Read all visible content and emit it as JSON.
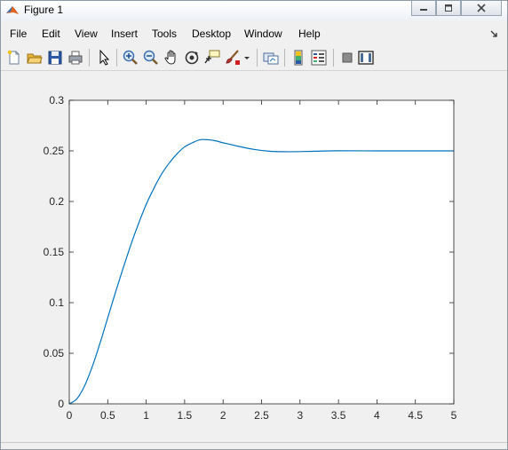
{
  "window": {
    "title": "Figure 1",
    "icons": {
      "app": "matlab-icon",
      "minimize": "minimize-icon",
      "maximize": "maximize-icon",
      "close": "close-icon"
    }
  },
  "menubar": {
    "items": [
      "File",
      "Edit",
      "View",
      "Insert",
      "Tools",
      "Desktop",
      "Window",
      "Help"
    ],
    "dock_icon": "dock-arrow-icon"
  },
  "toolbar": {
    "buttons": [
      "new-figure-icon",
      "open-file-icon",
      "save-icon",
      "print-icon",
      "edit-plot-pointer-icon",
      "zoom-in-icon",
      "zoom-out-icon",
      "pan-hand-icon",
      "rotate-3d-icon",
      "data-cursor-icon",
      "brush-icon",
      "brush-dropdown-icon",
      "link-plot-icon",
      "insert-colorbar-icon",
      "insert-legend-icon",
      "hide-plot-tools-icon",
      "show-plot-tools-icon"
    ]
  },
  "colors": {
    "line": "#0072bd",
    "axes_background": "#ffffff",
    "figure_background": "#f0f0f0",
    "axes_border": "#262626"
  },
  "chart_data": {
    "type": "line",
    "title": "",
    "xlabel": "",
    "ylabel": "",
    "xlim": [
      0,
      5
    ],
    "ylim": [
      0,
      0.3
    ],
    "xticks": [
      "0",
      "0.5",
      "1",
      "1.5",
      "2",
      "2.5",
      "3",
      "3.5",
      "4",
      "4.5",
      "5"
    ],
    "yticks": [
      "0",
      "0.05",
      "0.1",
      "0.15",
      "0.2",
      "0.25",
      "0.3"
    ],
    "grid": false,
    "legend": "none",
    "series": [
      {
        "x": [
          0,
          0.1,
          0.2,
          0.3,
          0.4,
          0.5,
          0.6,
          0.7,
          0.8,
          0.9,
          1.0,
          1.1,
          1.2,
          1.3,
          1.4,
          1.5,
          1.6,
          1.7,
          1.8,
          1.9,
          2.0,
          2.2,
          2.4,
          2.6,
          2.8,
          3.0,
          3.2,
          3.5,
          4.0,
          4.5,
          5.0
        ],
        "y": [
          0,
          0.005,
          0.018,
          0.037,
          0.06,
          0.085,
          0.11,
          0.134,
          0.157,
          0.178,
          0.197,
          0.213,
          0.227,
          0.238,
          0.247,
          0.254,
          0.258,
          0.261,
          0.261,
          0.26,
          0.258,
          0.2545,
          0.2515,
          0.2497,
          0.2492,
          0.2493,
          0.2497,
          0.2501,
          0.25,
          0.25,
          0.25
        ]
      }
    ]
  }
}
